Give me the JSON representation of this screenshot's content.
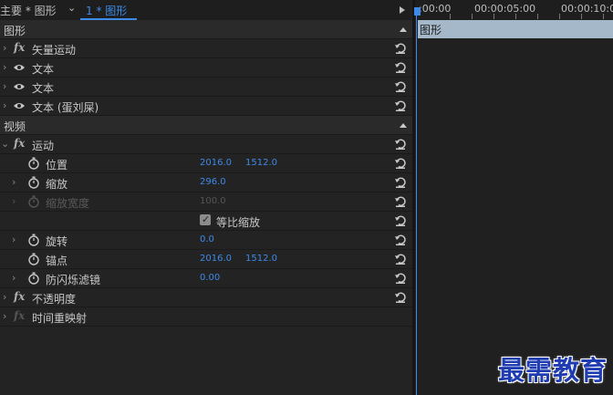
{
  "header": {
    "tab_main": "主要 * 图形",
    "tab_clip": "1 * 图形"
  },
  "sections": {
    "graphics": "图形",
    "video": "视频"
  },
  "graphics_layers": [
    {
      "fx": "fx",
      "label": "矢量运动"
    },
    {
      "label": "文本"
    },
    {
      "label": "文本"
    },
    {
      "label": "文本 (蛋刘屎)"
    }
  ],
  "video": {
    "motion": {
      "fx": "fx",
      "label": "运动"
    },
    "position": {
      "label": "位置",
      "x": "2016.0",
      "y": "1512.0"
    },
    "scale": {
      "label": "缩放",
      "value": "296.0"
    },
    "scale_width": {
      "label": "缩放宽度",
      "value": "100.0"
    },
    "uniform_scale": {
      "label": "等比缩放",
      "checked": true
    },
    "rotation": {
      "label": "旋转",
      "value": "0.0"
    },
    "anchor": {
      "label": "锚点",
      "x": "2016.0",
      "y": "1512.0"
    },
    "antiflicker": {
      "label": "防闪烁滤镜",
      "value": "0.00"
    },
    "opacity": {
      "fx": "fx",
      "label": "不透明度"
    },
    "time_remap": {
      "fx": "fx",
      "label": "时间重映射"
    }
  },
  "timeline": {
    "timecodes": [
      ":00:00",
      "00:00:05:00",
      "00:00:10:0"
    ],
    "clip_label": "图形"
  },
  "watermark": "最需教育",
  "colors": {
    "accent": "#3d8ae8",
    "clip": "#a4b8ca"
  }
}
